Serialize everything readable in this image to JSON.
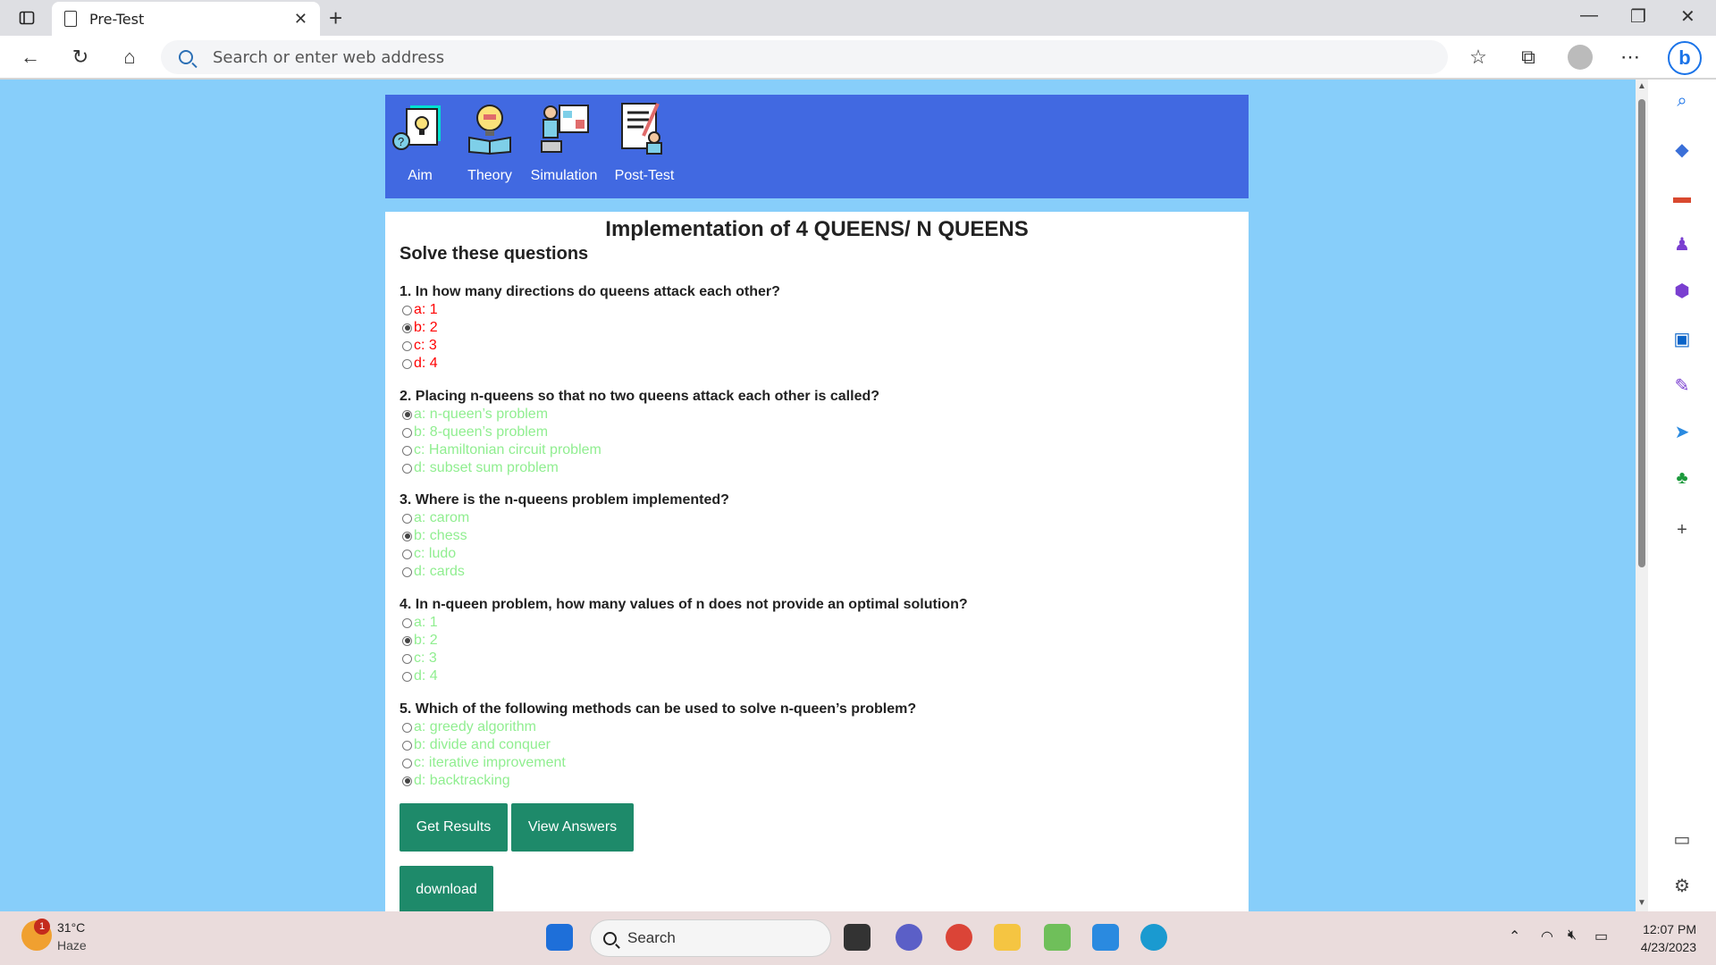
{
  "browser": {
    "tab_title": "Pre-Test",
    "address_placeholder": "Search or enter web address"
  },
  "site": {
    "nav": [
      {
        "label": "Aim",
        "icon": "scientist-lightbulb-icon"
      },
      {
        "label": "Theory",
        "icon": "lightbulb-book-icon"
      },
      {
        "label": "Simulation",
        "icon": "presentation-icon"
      },
      {
        "label": "Post-Test",
        "icon": "checklist-person-icon"
      }
    ],
    "heading": "Implementation of 4 QUEENS/ N QUEENS",
    "subheading": "Solve these questions",
    "questions": [
      {
        "text": "1. In how many directions do queens attack each other?",
        "color": "#ff0000",
        "options": [
          "a: 1",
          "b: 2",
          "c: 3",
          "d: 4"
        ],
        "selected": 1
      },
      {
        "text": "2. Placing n-queens so that no two queens attack each other is called?",
        "color": "#90ee90",
        "options": [
          "a: n-queen’s problem",
          "b: 8-queen’s problem",
          "c: Hamiltonian circuit problem",
          "d: subset sum problem"
        ],
        "selected": 0
      },
      {
        "text": "3. Where is the n-queens problem implemented?",
        "color": "#90ee90",
        "options": [
          "a: carom",
          "b: chess",
          "c: ludo",
          "d: cards"
        ],
        "selected": 1
      },
      {
        "text": "4. In n-queen problem, how many values of n does not provide an optimal solution?",
        "color": "#90ee90",
        "options": [
          "a: 1",
          "b: 2",
          "c: 3",
          "d: 4"
        ],
        "selected": 1
      },
      {
        "text": "5. Which of the following methods can be used to solve n-queen’s problem?",
        "color": "#90ee90",
        "options": [
          "a: greedy algorithm",
          "b: divide and conquer",
          "c: iterative improvement",
          "d: backtracking"
        ],
        "selected": 3
      }
    ],
    "buttons": {
      "get_results": "Get Results",
      "view_answers": "View Answers",
      "download": "download"
    },
    "colors": {
      "page_bg": "#87cefa",
      "header_bg": "#4169e1",
      "button_bg": "#1e8a6a"
    }
  },
  "taskbar": {
    "weather_badge": "1",
    "temperature": "31°C",
    "condition": "Haze",
    "search_label": "Search",
    "time": "12:07 PM",
    "date": "4/23/2023"
  }
}
